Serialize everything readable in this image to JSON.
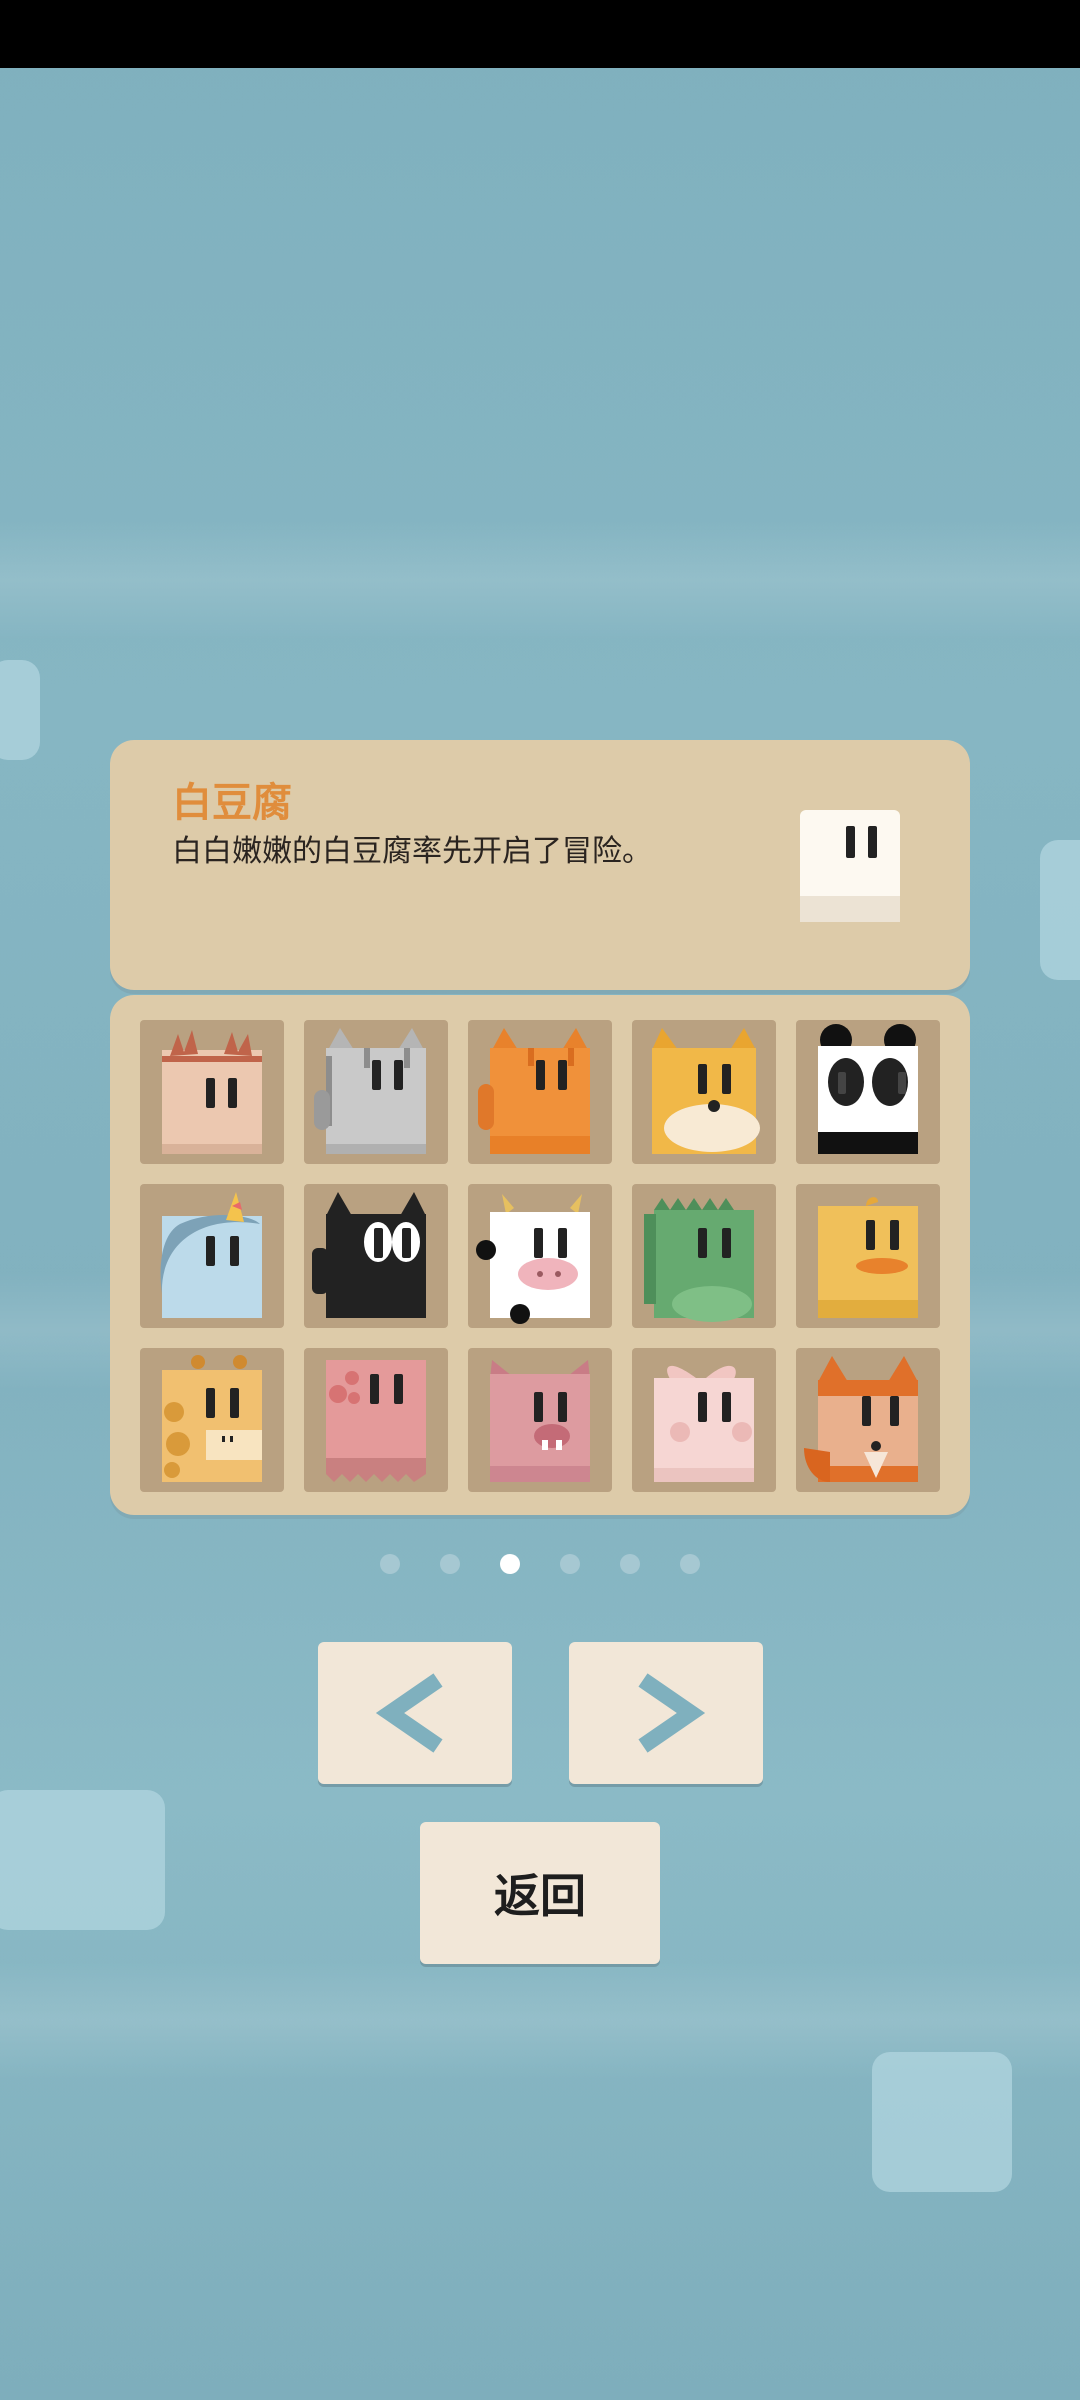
{
  "character": {
    "name": "白豆腐",
    "description": "白白嫩嫩的白豆腐率先开启了冒险。"
  },
  "characters": [
    {
      "id": "sea-urchin",
      "color": "#ecc8b0"
    },
    {
      "id": "gray-tabby-cat",
      "color": "#c9c9c9"
    },
    {
      "id": "orange-tabby-cat",
      "color": "#f0913a"
    },
    {
      "id": "shiba-dog",
      "color": "#f1b848"
    },
    {
      "id": "panda",
      "color": "#ffffff"
    },
    {
      "id": "unicorn",
      "color": "#bcdaea"
    },
    {
      "id": "black-cat",
      "color": "#222222"
    },
    {
      "id": "cow",
      "color": "#ffffff"
    },
    {
      "id": "dinosaur",
      "color": "#66aa70"
    },
    {
      "id": "duck",
      "color": "#f0c05a"
    },
    {
      "id": "giraffe",
      "color": "#f1c070"
    },
    {
      "id": "octopus",
      "color": "#e49a9a"
    },
    {
      "id": "pig",
      "color": "#dd9ba0"
    },
    {
      "id": "rabbit",
      "color": "#f6d6d3"
    },
    {
      "id": "fox",
      "color": "#e9b08d"
    }
  ],
  "pagination": {
    "pages": 6,
    "current": 3
  },
  "buttons": {
    "prev_icon": "chevron-left-icon",
    "next_icon": "chevron-right-icon",
    "back_label": "返回"
  },
  "colors": {
    "accent": "#e08d3c",
    "panel": "#ddcba9",
    "button": "#f2e7d8",
    "arrow": "#7fb0be"
  }
}
